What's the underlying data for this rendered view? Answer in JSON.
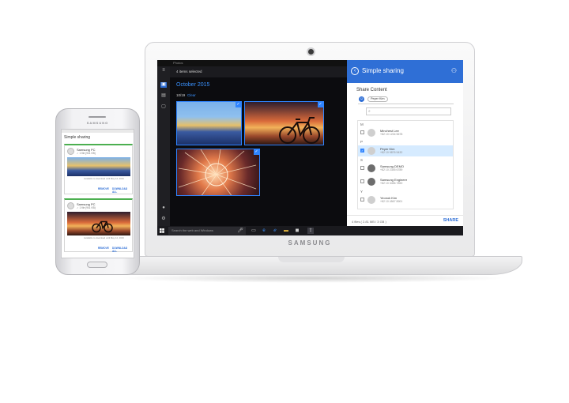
{
  "laptop": {
    "brand": "SAMSUNG",
    "photos_app": {
      "app_title": "Photos",
      "selection_status": "4 items selected",
      "month": "October 2015",
      "date": "10/19",
      "clear_label": "Clear",
      "photos": [
        {
          "selected": true
        },
        {
          "selected": true
        },
        {
          "selected": true
        }
      ]
    },
    "taskbar": {
      "search_placeholder": "Search the web and Windows"
    },
    "share_panel": {
      "title": "Simple sharing",
      "content_label": "Share Content",
      "recipient_chip": "Peyer Kim",
      "contacts": [
        {
          "section": "M",
          "name": "Minchest Lee",
          "number": "+82 10 1234 5678",
          "selected": false
        },
        {
          "section": "P",
          "name": "Peyer Kim",
          "number": "+82 10 9876 5432",
          "selected": true
        },
        {
          "section": "S",
          "name": "Samsung DEMO",
          "number": "+82 10 2345 6789",
          "selected": false
        },
        {
          "section": "",
          "name": "Samsung Engineer",
          "number": "+82 10 3456 7890",
          "selected": false
        },
        {
          "section": "Y",
          "name": "Yeonok Kim",
          "number": "+82 10 4567 8901",
          "selected": false
        }
      ],
      "files_info": "4 files ( 2.81 MB / 3 GB )",
      "share_button": "SHARE"
    }
  },
  "phone": {
    "brand": "SAMSUNG",
    "app_title": "Simple sharing",
    "cards": [
      {
        "sender": "Samsung PC",
        "files": "✓ 1 file (941 KB)",
        "note": "Available to download until May 12, 2016",
        "remove_label": "REMOVE",
        "download_label": "DOWNLOAD ALL"
      },
      {
        "sender": "Samsung PC",
        "files": "✓ 1 file (941 KB)",
        "note": "Available to download until May 12, 2016",
        "remove_label": "REMOVE",
        "download_label": "DOWNLOAD ALL"
      }
    ]
  },
  "colors": {
    "accent_blue": "#2f6fd6",
    "selection_blue": "#2f84ff",
    "card_green": "#4caf50"
  }
}
